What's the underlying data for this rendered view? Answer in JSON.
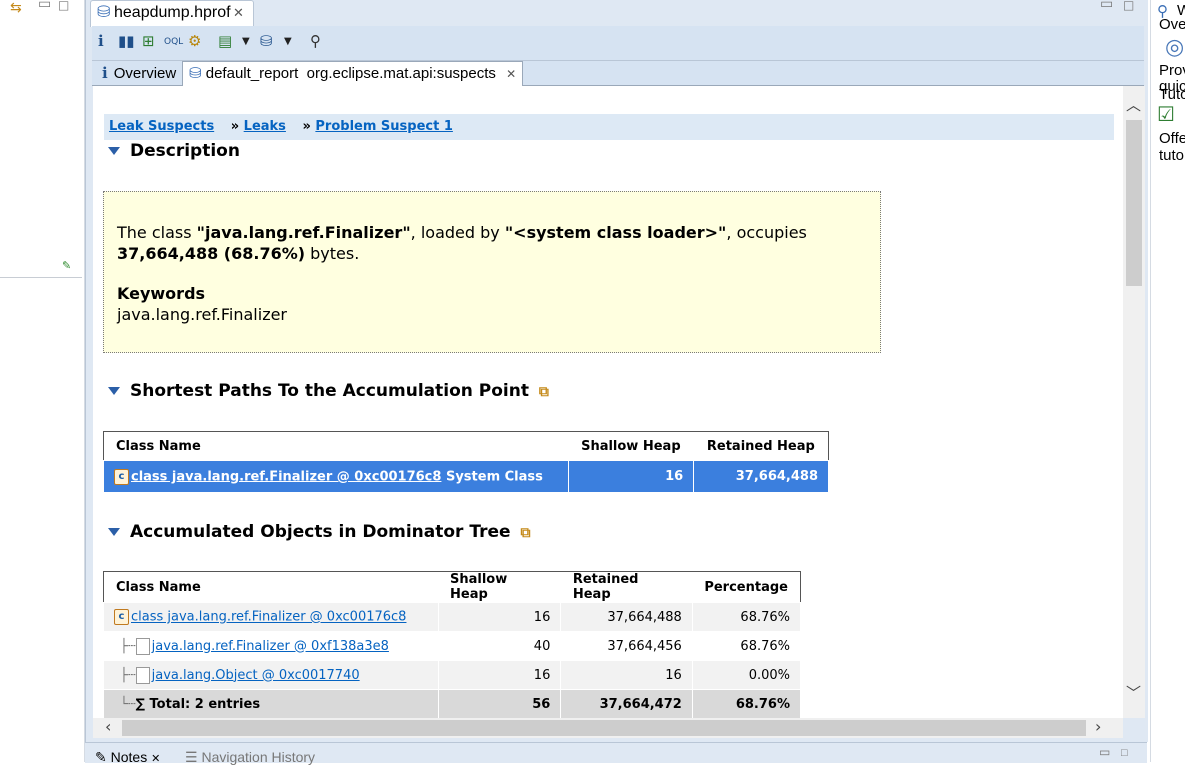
{
  "editor": {
    "tab_title": "heapdump.hprof",
    "subtabs": [
      {
        "label": "Overview"
      },
      {
        "label": "default_report  org.eclipse.mat.api:suspects"
      }
    ]
  },
  "breadcrumb": {
    "items": [
      "Leak Suspects",
      "Leaks",
      "Problem Suspect 1"
    ]
  },
  "description": {
    "heading": "Description",
    "text_prefix": "The class ",
    "class_name": "\"java.lang.ref.Finalizer\"",
    "loaded_by_text": ", loaded by ",
    "loader": "\"<system class loader>\"",
    "occupies_text": ", occupies",
    "size": "37,664,488 (68.76%)",
    "bytes_text": " bytes.",
    "keywords_heading": "Keywords",
    "keywords": "java.lang.ref.Finalizer"
  },
  "paths": {
    "heading": "Shortest Paths To the Accumulation Point",
    "columns": [
      "Class Name",
      "Shallow Heap",
      "Retained Heap"
    ],
    "row": {
      "name": "class java.lang.ref.Finalizer @ 0xc00176c8",
      "suffix": " System Class",
      "shallow": "16",
      "retained": "37,664,488"
    }
  },
  "dominator": {
    "heading": "Accumulated Objects in Dominator Tree",
    "columns": [
      "Class Name",
      "Shallow Heap",
      "Retained Heap",
      "Percentage"
    ],
    "rows": [
      {
        "name": "class java.lang.ref.Finalizer @ 0xc00176c8",
        "shallow": "16",
        "retained": "37,664,488",
        "pct": "68.76%"
      },
      {
        "name": "java.lang.ref.Finalizer @ 0xf138a3e8",
        "shallow": "40",
        "retained": "37,664,456",
        "pct": "68.76%"
      },
      {
        "name": "java.lang.Object @ 0xc0017740",
        "shallow": "16",
        "retained": "16",
        "pct": "0.00%"
      }
    ],
    "total": {
      "label": "Total: 2 entries",
      "shallow": "56",
      "retained": "37,664,472",
      "pct": "68.76%"
    }
  },
  "bottom_tabs": [
    "Notes",
    "Navigation History"
  ],
  "right_panel": {
    "lines": [
      "W",
      "Ove",
      "Prov",
      "quic",
      "Tuto",
      "Offe",
      "tutor"
    ]
  },
  "colors": {
    "selection": "#3b7fde",
    "link": "#0563c1",
    "highlight_box": "#ffffe0"
  }
}
